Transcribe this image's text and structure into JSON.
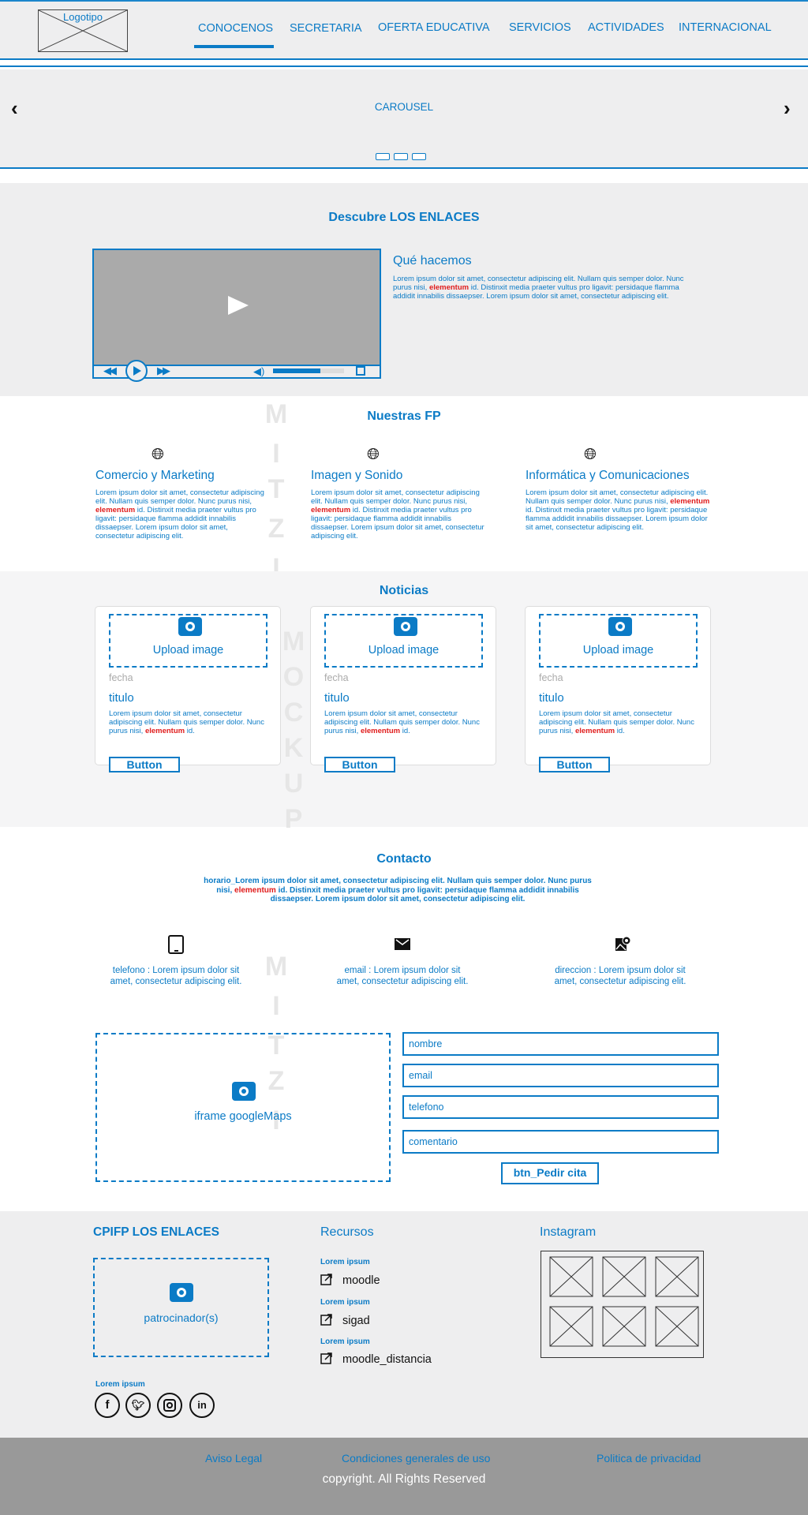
{
  "header": {
    "logo": "Logotipo",
    "nav": [
      "CONOCENOS",
      "SECRETARIA",
      "OFERTA EDUCATIVA",
      "SERVICIOS",
      "ACTIVIDADES",
      "INTERNACIONAL"
    ],
    "carousel": "CAROUSEL"
  },
  "watermark": [
    "M",
    "I",
    "T",
    "Z",
    "I",
    "M",
    "O",
    "C",
    "K",
    "U",
    "P",
    "M",
    "I",
    "T",
    "Z",
    "I"
  ],
  "about": {
    "title": "Descubre LOS ENLACES",
    "subtitle": "Qué hacemos",
    "text_a": "Lorem ipsum dolor sit amet, consectetur adipiscing elit. Nullam quis semper dolor. Nunc purus nisi, ",
    "text_em": "elementum",
    "text_b": " id. Distinxit  media praeter vultus pro ligavit: persidaque flamma addidit innabilis dissaepser. Lorem ipsum dolor sit amet, consectetur adipiscing elit."
  },
  "fp": {
    "title": "Nuestras FP",
    "items": [
      {
        "name": "Comercio y Marketing",
        "a": "Lorem ipsum dolor sit amet, consectetur adipiscing elit. Nullam quis semper dolor. Nunc purus nisi, ",
        "em": "elementum",
        "b": " id. Distinxit  media praeter vultus pro ligavit: persidaque flamma addidit innabilis dissaepser. Lorem ipsum dolor sit amet, consectetur adipiscing elit."
      },
      {
        "name": "Imagen y Sonido",
        "a": "Lorem ipsum dolor sit amet, consectetur adipiscing elit. Nullam quis semper dolor. Nunc purus nisi, ",
        "em": "elementum",
        "b": " id. Distinxit  media praeter vultus pro ligavit: persidaque flamma addidit innabilis dissaepser. Lorem ipsum dolor sit amet, consectetur adipiscing elit."
      },
      {
        "name": "Informática y Comunicaciones",
        "a": "Lorem ipsum dolor sit amet, consectetur adipiscing elit. Nullam quis semper dolor. Nunc purus nisi, ",
        "em": "elementum",
        "b": " id. Distinxit  media praeter vultus pro ligavit: persidaque flamma addidit innabilis dissaepser. Lorem ipsum dolor sit amet, consectetur adipiscing elit."
      }
    ]
  },
  "news": {
    "title": "Noticias",
    "cards": [
      {
        "upload": "Upload image",
        "fecha": "fecha",
        "titulo": "titulo",
        "a": "Lorem ipsum dolor sit amet, consectetur adipiscing elit. Nullam quis semper dolor. Nunc purus nisi, ",
        "em": "elementum",
        "b": " id.",
        "button": "Button"
      },
      {
        "upload": "Upload image",
        "fecha": "fecha",
        "titulo": "titulo",
        "a": "Lorem ipsum dolor sit amet, consectetur adipiscing elit. Nullam quis semper dolor. Nunc purus nisi, ",
        "em": "elementum",
        "b": " id.",
        "button": "Button"
      },
      {
        "upload": "Upload image",
        "fecha": "fecha",
        "titulo": "titulo",
        "a": "Lorem ipsum dolor sit amet, consectetur adipiscing elit. Nullam quis semper dolor. Nunc purus nisi, ",
        "em": "elementum",
        "b": " id.",
        "button": "Button"
      }
    ]
  },
  "contact": {
    "title": "Contacto",
    "horario_a": "horario_Lorem ipsum dolor sit amet, consectetur adipiscing elit. Nullam quis semper dolor. Nunc purus nisi, ",
    "horario_em": "elementum",
    "horario_b": " id. Distinxit  media praeter vultus pro ligavit: persidaque flamma addidit innabilis dissaepser. Lorem ipsum dolor sit amet, consectetur adipiscing elit.",
    "telefono": "telefono : Lorem ipsum dolor sit amet, consectetur adipiscing elit.",
    "email": "email : Lorem ipsum dolor sit amet, consectetur adipiscing elit.",
    "direccion": "direccion : Lorem ipsum dolor sit amet, consectetur adipiscing elit.",
    "map": "iframe googleMaps",
    "fields": [
      "nombre",
      "email",
      "telefono",
      "comentario"
    ],
    "submit": "btn_Pedir cita"
  },
  "footer": {
    "brand": "CPIFP LOS ENLACES",
    "sponsor": "patrocinador(s)",
    "social_label": "Lorem ipsum",
    "social_icons": [
      "facebook-icon",
      "twitter-icon",
      "instagram-icon",
      "linkedin-icon"
    ],
    "resources_title": "Recursos",
    "resources": [
      {
        "small": "Lorem ipsum",
        "label": "moodle"
      },
      {
        "small": "Lorem ipsum",
        "label": "sigad"
      },
      {
        "small": "Lorem ipsum",
        "label": "moodle_distancia"
      }
    ],
    "instagram_title": "Instagram",
    "links": [
      "Aviso Legal",
      "Condiciones generales de uso",
      "Politica de privacidad"
    ],
    "copyright": "copyright. All Rights Reserved"
  },
  "colors": {
    "accent": "#0b7bc6",
    "highlight": "#e01b1b",
    "panel": "#eeeeef",
    "bottom_bar": "#999999"
  }
}
